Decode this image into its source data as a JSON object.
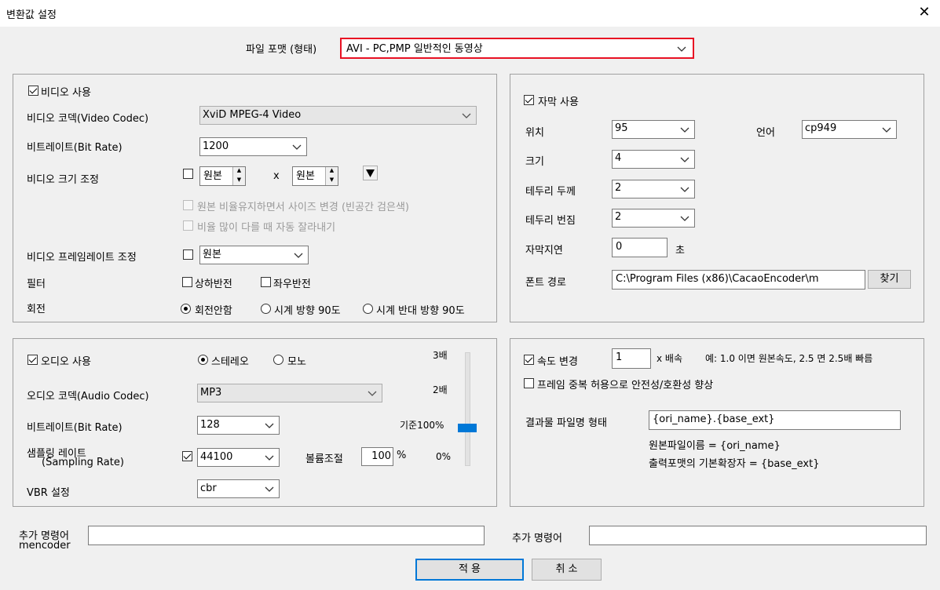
{
  "window": {
    "title": "변환값 설정",
    "close": "✕"
  },
  "format": {
    "label": "파일 포맷 (형태)",
    "value": "AVI - PC,PMP 일반적인 동영상"
  },
  "video": {
    "use_label": "비디오 사용",
    "codec_label": "비디오 코덱(Video Codec)",
    "codec_value": "XviD MPEG-4 Video",
    "bitrate_label": "비트레이트(Bit Rate)",
    "bitrate_value": "1200",
    "size_label": "비디오 크기 조정",
    "size_w": "원본",
    "size_x": "x",
    "size_h": "원본",
    "keep_ratio": "원본 비율유지하면서 사이즈 변경 (빈공간 검은색)",
    "auto_crop": "비율 많이 다를 때 자동 잘라내기",
    "framerate_label": "비디오 프레임레이트 조정",
    "framerate_value": "원본",
    "filter_label": "필터",
    "flip_v": "상하반전",
    "flip_h": "좌우반전",
    "rotate_label": "회전",
    "rot_none": "회전안함",
    "rot_cw": "시계 방향 90도",
    "rot_ccw": "시계 반대 방향 90도"
  },
  "subtitle": {
    "use_label": "자막 사용",
    "pos_label": "위치",
    "pos_value": "95",
    "lang_label": "언어",
    "lang_value": "cp949",
    "size_label": "크기",
    "size_value": "4",
    "border_label": "테두리 두께",
    "border_value": "2",
    "blur_label": "테두리 번짐",
    "blur_value": "2",
    "delay_label": "자막지연",
    "delay_value": "0",
    "delay_unit": "초",
    "font_label": "폰트 경로",
    "font_value": "C:\\Program Files (x86)\\CacaoEncoder\\m",
    "find_button": "찾기"
  },
  "audio": {
    "use_label": "오디오 사용",
    "stereo": "스테레오",
    "mono": "모노",
    "codec_label": "오디오 코덱(Audio Codec)",
    "codec_value": "MP3",
    "bitrate_label": "비트레이트(Bit Rate)",
    "bitrate_value": "128",
    "sampling_label1": "샘플링 레이트",
    "sampling_label2": "(Sampling Rate)",
    "sampling_value": "44100",
    "volume_label": "볼륨조절",
    "volume_value": "100",
    "volume_unit": "%",
    "vbr_label": "VBR 설정",
    "vbr_value": "cbr",
    "scale_3x": "3배",
    "scale_2x": "2배",
    "scale_base": "기준100%",
    "scale_0": "0%",
    "volume_level": 0.33
  },
  "speed": {
    "label": "속도 변경",
    "value": "1",
    "unit": "x 배속",
    "example": "예: 1.0 이면 원본속도, 2.5 면 2.5배 빠름",
    "frame_dup": "프레임 중복 허용으로 안전성/호환성 향상",
    "filename_label": "결과물 파일명 형태",
    "filename_value": "{ori_name}.{base_ext}",
    "hint1": "원본파일이름 = {ori_name}",
    "hint2": "출력포맷의 기본확장자 = {base_ext}"
  },
  "extra": {
    "label_left1": "추가 명령어",
    "label_left2": "mencoder",
    "label_right": "추가 명령어",
    "value_left": "",
    "value_right": ""
  },
  "buttons": {
    "apply": "적 용",
    "cancel": "취 소"
  },
  "colors": {
    "accent": "#0078d7",
    "highlight_border": "#e81123"
  }
}
